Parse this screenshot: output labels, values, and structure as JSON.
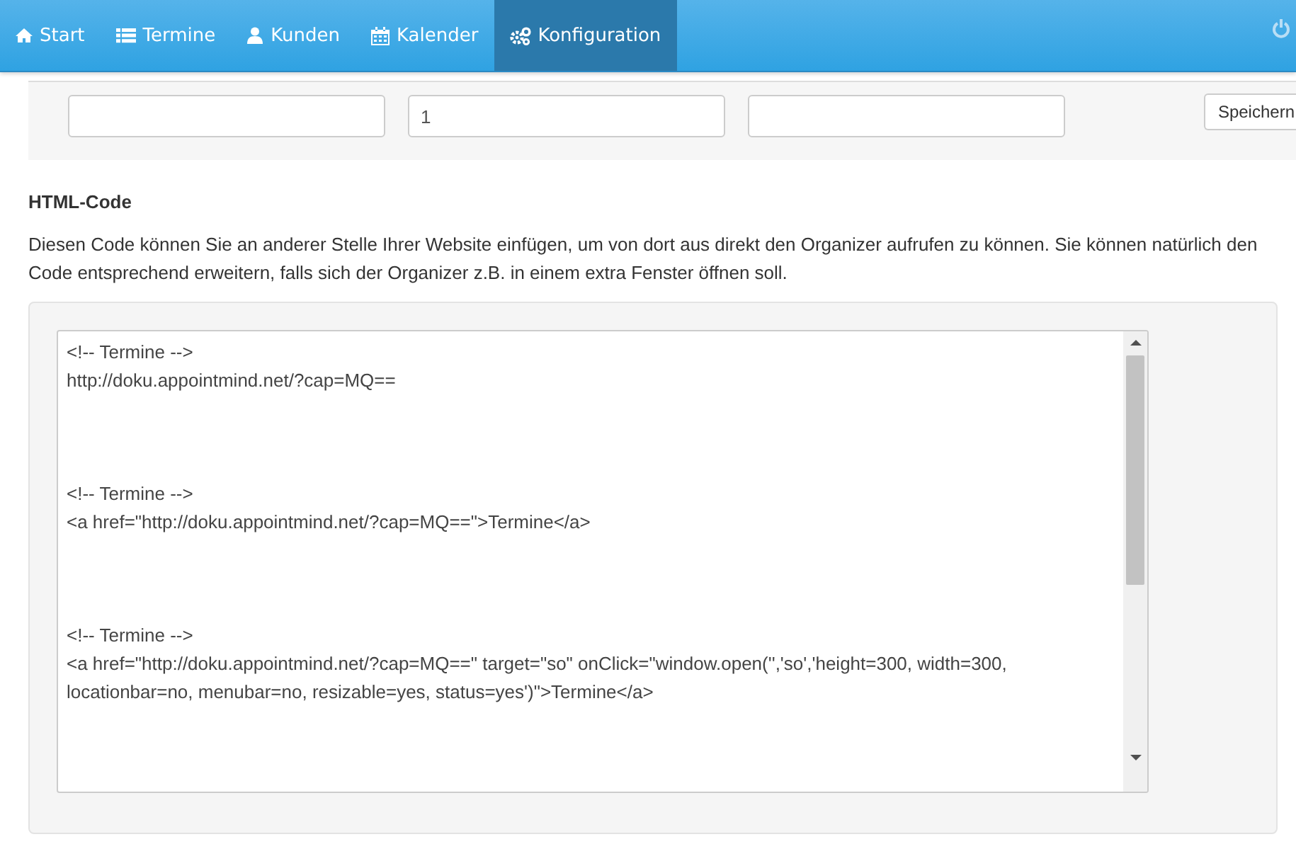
{
  "nav": {
    "items": [
      {
        "label": "Start",
        "selected": false
      },
      {
        "label": "Termine",
        "selected": false
      },
      {
        "label": "Kunden",
        "selected": false
      },
      {
        "label": "Kalender",
        "selected": false
      },
      {
        "label": "Konfiguration",
        "selected": true
      }
    ]
  },
  "form": {
    "fields": [
      {
        "kind": "empty"
      },
      {
        "kind": "filled",
        "value": "1"
      },
      {
        "kind": "empty"
      }
    ],
    "button": "Speichern"
  },
  "section": {
    "title": "HTML-Code",
    "description": "Diesen Code können Sie an anderer Stelle Ihrer Website einfügen, um von dort aus direkt den Organizer aufrufen zu können. Sie können natürlich den Code entsprechend erweitern, falls sich der Organizer z.B. in einem extra Fenster öffnen soll.",
    "code": "<!-- Termine -->\nhttp://doku.appointmind.net/?cap=MQ==\n\n\n\n<!-- Termine -->\n<a href=\"http://doku.appointmind.net/?cap=MQ==\">Termine</a>\n\n\n\n<!-- Termine -->\n<a href=\"http://doku.appointmind.net/?cap=MQ==\" target=\"so\" onClick=\"window.open('','so','height=300, width=300, locationbar=no, menubar=no, resizable=yes, status=yes')\">Termine</a>"
  }
}
